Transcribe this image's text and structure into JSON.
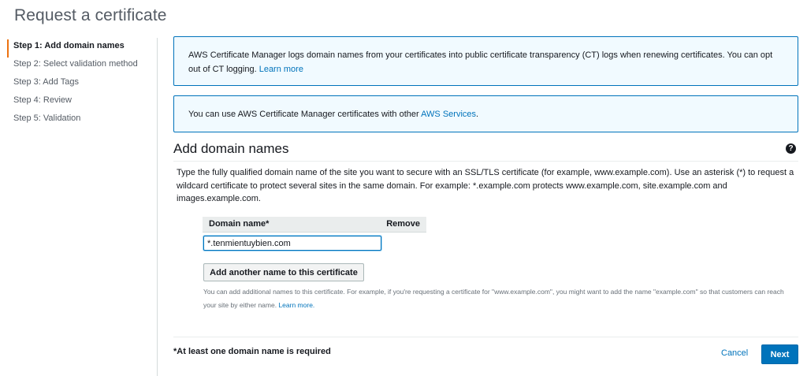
{
  "page": {
    "title": "Request a certificate"
  },
  "steps": [
    {
      "label": "Step 1: Add domain names",
      "active": true
    },
    {
      "label": "Step 2: Select validation method",
      "active": false
    },
    {
      "label": "Step 3: Add Tags",
      "active": false
    },
    {
      "label": "Step 4: Review",
      "active": false
    },
    {
      "label": "Step 5: Validation",
      "active": false
    }
  ],
  "info_ct": {
    "text": "AWS Certificate Manager logs domain names from your certificates into public certificate transparency (CT) logs when renewing certificates. You can opt out of CT logging.",
    "link": "Learn more"
  },
  "info_services": {
    "text": "You can use AWS Certificate Manager certificates with other",
    "link": "AWS Services",
    "suffix": "."
  },
  "section": {
    "title": "Add domain names",
    "help_icon": "question-circle-icon",
    "description": "Type the fully qualified domain name of the site you want to secure with an SSL/TLS certificate (for example, www.example.com). Use an asterisk (*) to request a wildcard certificate to protect several sites in the same domain. For example: *.example.com protects www.example.com, site.example.com and images.example.com."
  },
  "domain_table": {
    "headers": {
      "domain": "Domain name*",
      "remove": "Remove"
    },
    "input_value": "*.tenmientuybien.com"
  },
  "add_button": "Add another name to this certificate",
  "hint": {
    "text": "You can add additional names to this certificate. For example, if you're requesting a certificate for \"www.example.com\", you might want to add the name \"example.com\" so that customers can reach your site by either name.",
    "link": "Learn more."
  },
  "footer": {
    "required_note": "*At least one domain name is required",
    "cancel": "Cancel",
    "next": "Next"
  },
  "colors": {
    "accent": "#ec7211",
    "link": "#0073bb",
    "primary_button": "#0073bb"
  }
}
